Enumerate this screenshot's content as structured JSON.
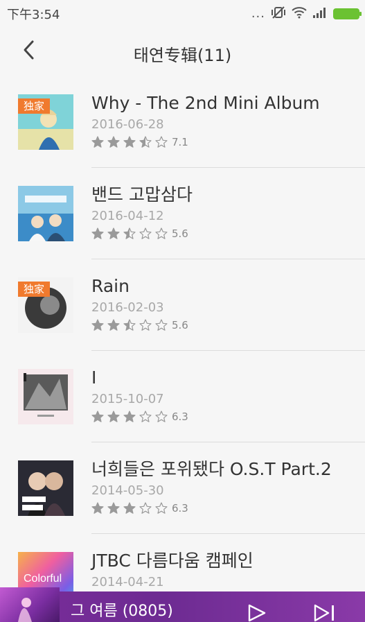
{
  "status": {
    "time": "下午3:54",
    "dots": "...",
    "battery_color": "#6bc232"
  },
  "header": {
    "title": "태연专辑(11)",
    "back_icon": "chevron-left-icon"
  },
  "albums": [
    {
      "name": "Why - The 2nd Mini Album",
      "date": "2016-06-28",
      "rating": 3.5,
      "score": "7.1",
      "badge": "独家",
      "cover": "cover-why"
    },
    {
      "name": "밴드 고맙삼다",
      "date": "2016-04-12",
      "rating": 2.5,
      "score": "5.6",
      "badge": "",
      "cover": "cover-band"
    },
    {
      "name": "Rain",
      "date": "2016-02-03",
      "rating": 2.5,
      "score": "5.6",
      "badge": "独家",
      "cover": "cover-rain"
    },
    {
      "name": "I",
      "date": "2015-10-07",
      "rating": 3,
      "score": "6.3",
      "badge": "",
      "cover": "cover-i"
    },
    {
      "name": "너희들은 포위됐다 O.S.T Part.2",
      "date": "2014-05-30",
      "rating": 3,
      "score": "6.3",
      "badge": "",
      "cover": "cover-ost"
    },
    {
      "name": "JTBC 다름다움 캠페인",
      "date": "2014-04-21",
      "rating": null,
      "score": "",
      "badge": "",
      "cover": "cover-colorful",
      "cover_text": "Colorful"
    }
  ],
  "player": {
    "song": "그 여름 (0805)",
    "play_icon": "play-icon",
    "next_icon": "skip-next-icon",
    "bg": "#6d2b92"
  }
}
